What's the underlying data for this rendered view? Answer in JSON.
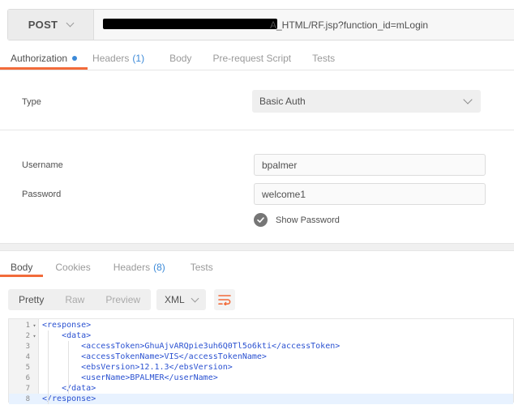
{
  "request": {
    "method": "POST",
    "url_suffix": "A_HTML/RF.jsp?function_id=mLogin"
  },
  "request_tabs": [
    {
      "label": "Authorization",
      "active": true,
      "dot": true
    },
    {
      "label": "Headers",
      "count": "(1)"
    },
    {
      "label": "Body"
    },
    {
      "label": "Pre-request Script"
    },
    {
      "label": "Tests"
    }
  ],
  "auth": {
    "type_label": "Type",
    "type_value": "Basic Auth",
    "username_label": "Username",
    "username_value": "bpalmer",
    "password_label": "Password",
    "password_value": "welcome1",
    "show_password_label": "Show Password",
    "show_password_checked": true
  },
  "response_tabs": [
    {
      "label": "Body",
      "active": true
    },
    {
      "label": "Cookies"
    },
    {
      "label": "Headers",
      "count": "(8)"
    },
    {
      "label": "Tests"
    }
  ],
  "view_modes": [
    {
      "label": "Pretty",
      "active": true
    },
    {
      "label": "Raw"
    },
    {
      "label": "Preview"
    }
  ],
  "format": "XML",
  "icons": {
    "method_chevron": "chevron-down-icon",
    "type_chevron": "chevron-down-icon",
    "format_chevron": "chevron-down-icon",
    "wrap": "wrap-lines-icon",
    "checkbox": "check-icon"
  },
  "colors": {
    "accent": "#f26b3a",
    "count_blue": "#3c8ad8",
    "code_text": "#2b52d1"
  },
  "code_lines": [
    {
      "n": "1",
      "fold": "▾",
      "text": "<response>"
    },
    {
      "n": "2",
      "fold": "▾",
      "text": "    <data>"
    },
    {
      "n": "3",
      "fold": "",
      "text": "        <accessToken>GhuAjvARQpie3uh6Q0Tl5o6kti</accessToken>"
    },
    {
      "n": "4",
      "fold": "",
      "text": "        <accessTokenName>VIS</accessTokenName>"
    },
    {
      "n": "5",
      "fold": "",
      "text": "        <ebsVersion>12.1.3</ebsVersion>"
    },
    {
      "n": "6",
      "fold": "",
      "text": "        <userName>BPALMER</userName>"
    },
    {
      "n": "7",
      "fold": "",
      "text": "    </data>"
    },
    {
      "n": "8",
      "fold": "",
      "text": "</response>",
      "highlight": true
    }
  ]
}
